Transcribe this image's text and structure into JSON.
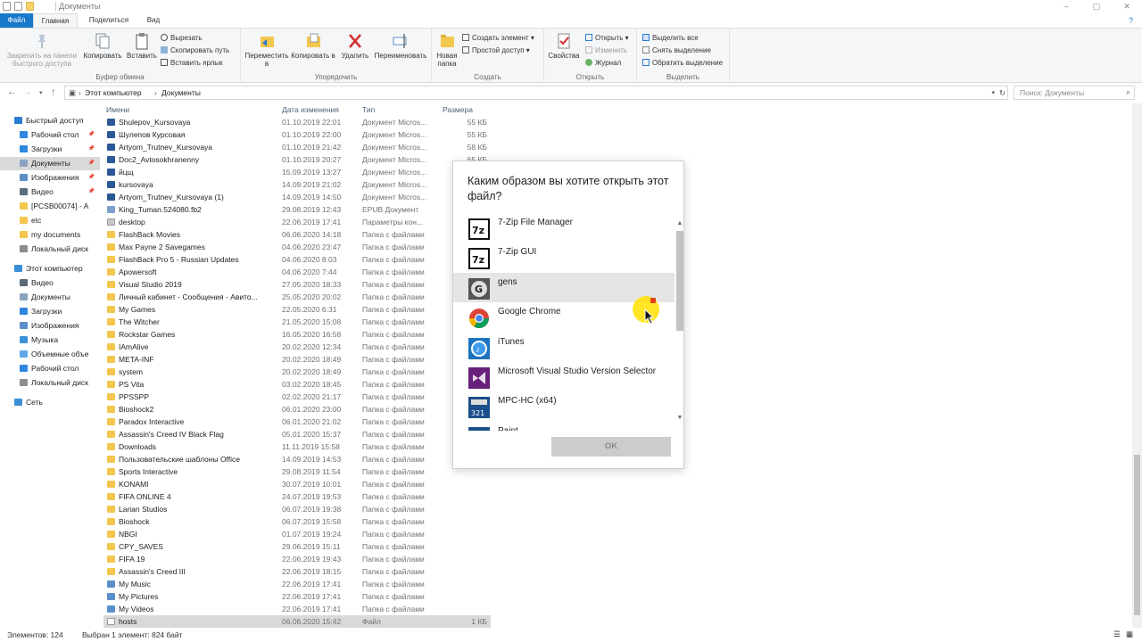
{
  "window": {
    "title": "Документы",
    "controls": [
      "–",
      "▢",
      "✕"
    ]
  },
  "tabs": {
    "file": "Файл",
    "home": "Главная",
    "share": "Поделиться",
    "view": "Вид"
  },
  "ribbon": {
    "clipboard": {
      "label": "Буфер обмена",
      "pin": "Закрепить на панели быстрого доступа",
      "copy": "Копировать",
      "paste": "Вставить",
      "cut": "Вырезать",
      "copy_path": "Скопировать путь",
      "paste_shortcut": "Вставить ярлык"
    },
    "organize": {
      "label": "Упорядочить",
      "move": "Переместить в",
      "copy_to": "Копировать в",
      "delete": "Удалить",
      "rename": "Переименовать"
    },
    "create": {
      "label": "Создать",
      "new_folder": "Новая папка",
      "new_item": "Создать элемент",
      "easy_access": "Простой доступ"
    },
    "open": {
      "label": "Открыть",
      "properties": "Свойства",
      "open": "Открыть",
      "edit": "Изменить",
      "history": "Журнал"
    },
    "select": {
      "label": "Выделить",
      "select_all": "Выделить все",
      "select_none": "Снять выделение",
      "invert": "Обратить выделение"
    }
  },
  "address": {
    "breadcrumb": [
      "Этот компьютер",
      "Документы"
    ],
    "search_placeholder": "Поиск: Документы"
  },
  "nav": [
    {
      "label": "Быстрый доступ",
      "icon": "star-icon",
      "color": "#2b7cd3",
      "indent": 0,
      "pin": false
    },
    {
      "label": "Рабочий стол",
      "icon": "desktop-icon",
      "color": "#2e86de",
      "indent": 1,
      "pin": true
    },
    {
      "label": "Загрузки",
      "icon": "download-icon",
      "color": "#2e86de",
      "indent": 1,
      "pin": true
    },
    {
      "label": "Документы",
      "icon": "documents-icon",
      "color": "#8aa4bf",
      "indent": 1,
      "pin": true,
      "selected": true
    },
    {
      "label": "Изображения",
      "icon": "pictures-icon",
      "color": "#5a8fc9",
      "indent": 1,
      "pin": true
    },
    {
      "label": "Видео",
      "icon": "video-icon",
      "color": "#5c6b7a",
      "indent": 1,
      "pin": true
    },
    {
      "label": "[PCSB00074] - A",
      "icon": "folder-icon",
      "color": "#f3c64d",
      "indent": 1,
      "pin": false
    },
    {
      "label": "etc",
      "icon": "folder-icon",
      "color": "#f3c64d",
      "indent": 1,
      "pin": false
    },
    {
      "label": "my documents",
      "icon": "folder-icon",
      "color": "#f3c64d",
      "indent": 1,
      "pin": false
    },
    {
      "label": "Локальный диск",
      "icon": "drive-icon",
      "color": "#8c8c8c",
      "indent": 1,
      "pin": false
    },
    {
      "label": "Этот компьютер",
      "icon": "computer-icon",
      "color": "#3c8fd6",
      "indent": 0,
      "pin": false
    },
    {
      "label": "Видео",
      "icon": "video-icon",
      "color": "#5c6b7a",
      "indent": 1,
      "pin": false
    },
    {
      "label": "Документы",
      "icon": "documents-icon",
      "color": "#8aa4bf",
      "indent": 1,
      "pin": false
    },
    {
      "label": "Загрузки",
      "icon": "download-icon",
      "color": "#2e86de",
      "indent": 1,
      "pin": false
    },
    {
      "label": "Изображения",
      "icon": "pictures-icon",
      "color": "#5a8fc9",
      "indent": 1,
      "pin": false
    },
    {
      "label": "Музыка",
      "icon": "music-icon",
      "color": "#3c8fd6",
      "indent": 1,
      "pin": false
    },
    {
      "label": "Объемные объе",
      "icon": "3d-objects-icon",
      "color": "#5fa8e8",
      "indent": 1,
      "pin": false
    },
    {
      "label": "Рабочий стол",
      "icon": "desktop-icon",
      "color": "#2e86de",
      "indent": 1,
      "pin": false
    },
    {
      "label": "Локальный диск",
      "icon": "drive-icon",
      "color": "#8c8c8c",
      "indent": 1,
      "pin": false
    },
    {
      "label": "Сеть",
      "icon": "network-icon",
      "color": "#3c8fd6",
      "indent": 0,
      "pin": false
    }
  ],
  "columns": {
    "name": "Имени",
    "date": "Дата изменения",
    "type": "Тип",
    "size": "Размера"
  },
  "files": [
    {
      "name": "Shulepov_Kursovaya",
      "date": "01.10.2019 22:01",
      "type": "Документ Micros...",
      "size": "55 КБ",
      "kind": "doc"
    },
    {
      "name": "Шулепов Курсовая",
      "date": "01.10.2019 22:00",
      "type": "Документ Micros...",
      "size": "55 КБ",
      "kind": "doc"
    },
    {
      "name": "Artyom_Trutnev_Kursovaya",
      "date": "01.10.2019 21:42",
      "type": "Документ Micros...",
      "size": "58 КБ",
      "kind": "doc"
    },
    {
      "name": "Doc2_Avtosokhranenny",
      "date": "01.10.2019 20:27",
      "type": "Документ Micros...",
      "size": "65 КБ",
      "kind": "doc"
    },
    {
      "name": "йцщ",
      "date": "15.09.2019 13:27",
      "type": "Документ Micros...",
      "size": "",
      "kind": "doc"
    },
    {
      "name": "kursovaya",
      "date": "14.09.2019 21:02",
      "type": "Документ Micros...",
      "size": "",
      "kind": "doc"
    },
    {
      "name": "Artyom_Trutnev_Kursovaya (1)",
      "date": "14.09.2019 14:50",
      "type": "Документ Micros...",
      "size": "",
      "kind": "doc"
    },
    {
      "name": "King_Tuman.524080.fb2",
      "date": "29.08.2019 12:43",
      "type": "EPUB Документ",
      "size": "",
      "kind": "epub"
    },
    {
      "name": "desktop",
      "date": "22.06.2019 17:41",
      "type": "Параметры кон...",
      "size": "",
      "kind": "ini"
    },
    {
      "name": "FlashBack Movies",
      "date": "06.06.2020 14:18",
      "type": "Папка с файлами",
      "size": "",
      "kind": "folder"
    },
    {
      "name": "Max Payne 2 Savegames",
      "date": "04.06.2020 23:47",
      "type": "Папка с файлами",
      "size": "",
      "kind": "folder"
    },
    {
      "name": "FlashBack Pro 5 - Russian Updates",
      "date": "04.06.2020 8:03",
      "type": "Папка с файлами",
      "size": "",
      "kind": "folder"
    },
    {
      "name": "Apowersoft",
      "date": "04.06.2020 7:44",
      "type": "Папка с файлами",
      "size": "",
      "kind": "folder"
    },
    {
      "name": "Visual Studio 2019",
      "date": "27.05.2020 18:33",
      "type": "Папка с файлами",
      "size": "",
      "kind": "folder"
    },
    {
      "name": "Личный кабинет - Сообщения - Авито...",
      "date": "25.05.2020 20:02",
      "type": "Папка с файлами",
      "size": "",
      "kind": "folder"
    },
    {
      "name": "My Games",
      "date": "22.05.2020 6:31",
      "type": "Папка с файлами",
      "size": "",
      "kind": "folder"
    },
    {
      "name": "The Witcher",
      "date": "21.05.2020 15:08",
      "type": "Папка с файлами",
      "size": "",
      "kind": "folder"
    },
    {
      "name": "Rockstar Games",
      "date": "16.05.2020 16:58",
      "type": "Папка с файлами",
      "size": "",
      "kind": "folder"
    },
    {
      "name": "IAmAlive",
      "date": "20.02.2020 12:34",
      "type": "Папка с файлами",
      "size": "",
      "kind": "folder"
    },
    {
      "name": "META-INF",
      "date": "20.02.2020 18:49",
      "type": "Папка с файлами",
      "size": "",
      "kind": "folder"
    },
    {
      "name": "system",
      "date": "20.02.2020 18:49",
      "type": "Папка с файлами",
      "size": "",
      "kind": "folder"
    },
    {
      "name": "PS Vita",
      "date": "03.02.2020 18:45",
      "type": "Папка с файлами",
      "size": "",
      "kind": "folder"
    },
    {
      "name": "PPSSPP",
      "date": "02.02.2020 21:17",
      "type": "Папка с файлами",
      "size": "",
      "kind": "folder"
    },
    {
      "name": "Bioshock2",
      "date": "06.01.2020 23:00",
      "type": "Папка с файлами",
      "size": "",
      "kind": "folder"
    },
    {
      "name": "Paradox Interactive",
      "date": "06.01.2020 21:02",
      "type": "Папка с файлами",
      "size": "",
      "kind": "folder"
    },
    {
      "name": "Assassin's Creed IV Black Flag",
      "date": "05.01.2020 15:37",
      "type": "Папка с файлами",
      "size": "",
      "kind": "folder"
    },
    {
      "name": "Downloads",
      "date": "11.11.2019 15:58",
      "type": "Папка с файлами",
      "size": "",
      "kind": "folder"
    },
    {
      "name": "Пользовательские шаблоны Office",
      "date": "14.09.2019 14:53",
      "type": "Папка с файлами",
      "size": "",
      "kind": "folder"
    },
    {
      "name": "Sports Interactive",
      "date": "29.08.2019 11:54",
      "type": "Папка с файлами",
      "size": "",
      "kind": "folder"
    },
    {
      "name": "KONAMI",
      "date": "30.07.2019 10:01",
      "type": "Папка с файлами",
      "size": "",
      "kind": "folder"
    },
    {
      "name": "FIFA ONLINE 4",
      "date": "24.07.2019 19:53",
      "type": "Папка с файлами",
      "size": "",
      "kind": "folder"
    },
    {
      "name": "Larian Studios",
      "date": "06.07.2019 19:38",
      "type": "Папка с файлами",
      "size": "",
      "kind": "folder"
    },
    {
      "name": "Bioshock",
      "date": "06.07.2019 15:58",
      "type": "Папка с файлами",
      "size": "",
      "kind": "folder"
    },
    {
      "name": "NBGI",
      "date": "01.07.2019 19:24",
      "type": "Папка с файлами",
      "size": "",
      "kind": "folder"
    },
    {
      "name": "CPY_SAVES",
      "date": "29.06.2019 15:11",
      "type": "Папка с файлами",
      "size": "",
      "kind": "folder"
    },
    {
      "name": "FIFA 19",
      "date": "22.06.2019 19:43",
      "type": "Папка с файлами",
      "size": "",
      "kind": "folder"
    },
    {
      "name": "Assassin's Creed III",
      "date": "22.06.2019 18:15",
      "type": "Папка с файлами",
      "size": "",
      "kind": "folder"
    },
    {
      "name": "My Music",
      "date": "22.06.2019 17:41",
      "type": "Папка с файлами",
      "size": "",
      "kind": "shortcut"
    },
    {
      "name": "My Pictures",
      "date": "22.06.2019 17:41",
      "type": "Папка с файлами",
      "size": "",
      "kind": "shortcut"
    },
    {
      "name": "My Videos",
      "date": "22.06.2019 17:41",
      "type": "Папка с файлами",
      "size": "",
      "kind": "shortcut"
    },
    {
      "name": "hosts",
      "date": "06.06.2020 15:42",
      "type": "Файл",
      "size": "1 КБ",
      "kind": "file",
      "selected": true
    }
  ],
  "status": {
    "count": "Элементов: 124",
    "selection": "Выбран 1 элемент: 824 байт"
  },
  "dialog": {
    "title": "Каким образом вы хотите открыть этот файл?",
    "apps": [
      {
        "name": "7-Zip File Manager",
        "icon": "7zip-icon"
      },
      {
        "name": "7-Zip GUI",
        "icon": "7zip-icon"
      },
      {
        "name": "gens",
        "icon": "gens-icon",
        "highlighted": true
      },
      {
        "name": "Google Chrome",
        "icon": "chrome-icon"
      },
      {
        "name": "iTunes",
        "icon": "itunes-icon"
      },
      {
        "name": "Microsoft Visual Studio Version Selector",
        "icon": "visual-studio-icon"
      },
      {
        "name": "MPC-HC (x64)",
        "icon": "mpc-hc-icon"
      },
      {
        "name": "Paint",
        "icon": "paint-icon"
      }
    ],
    "ok_label": "OK"
  }
}
